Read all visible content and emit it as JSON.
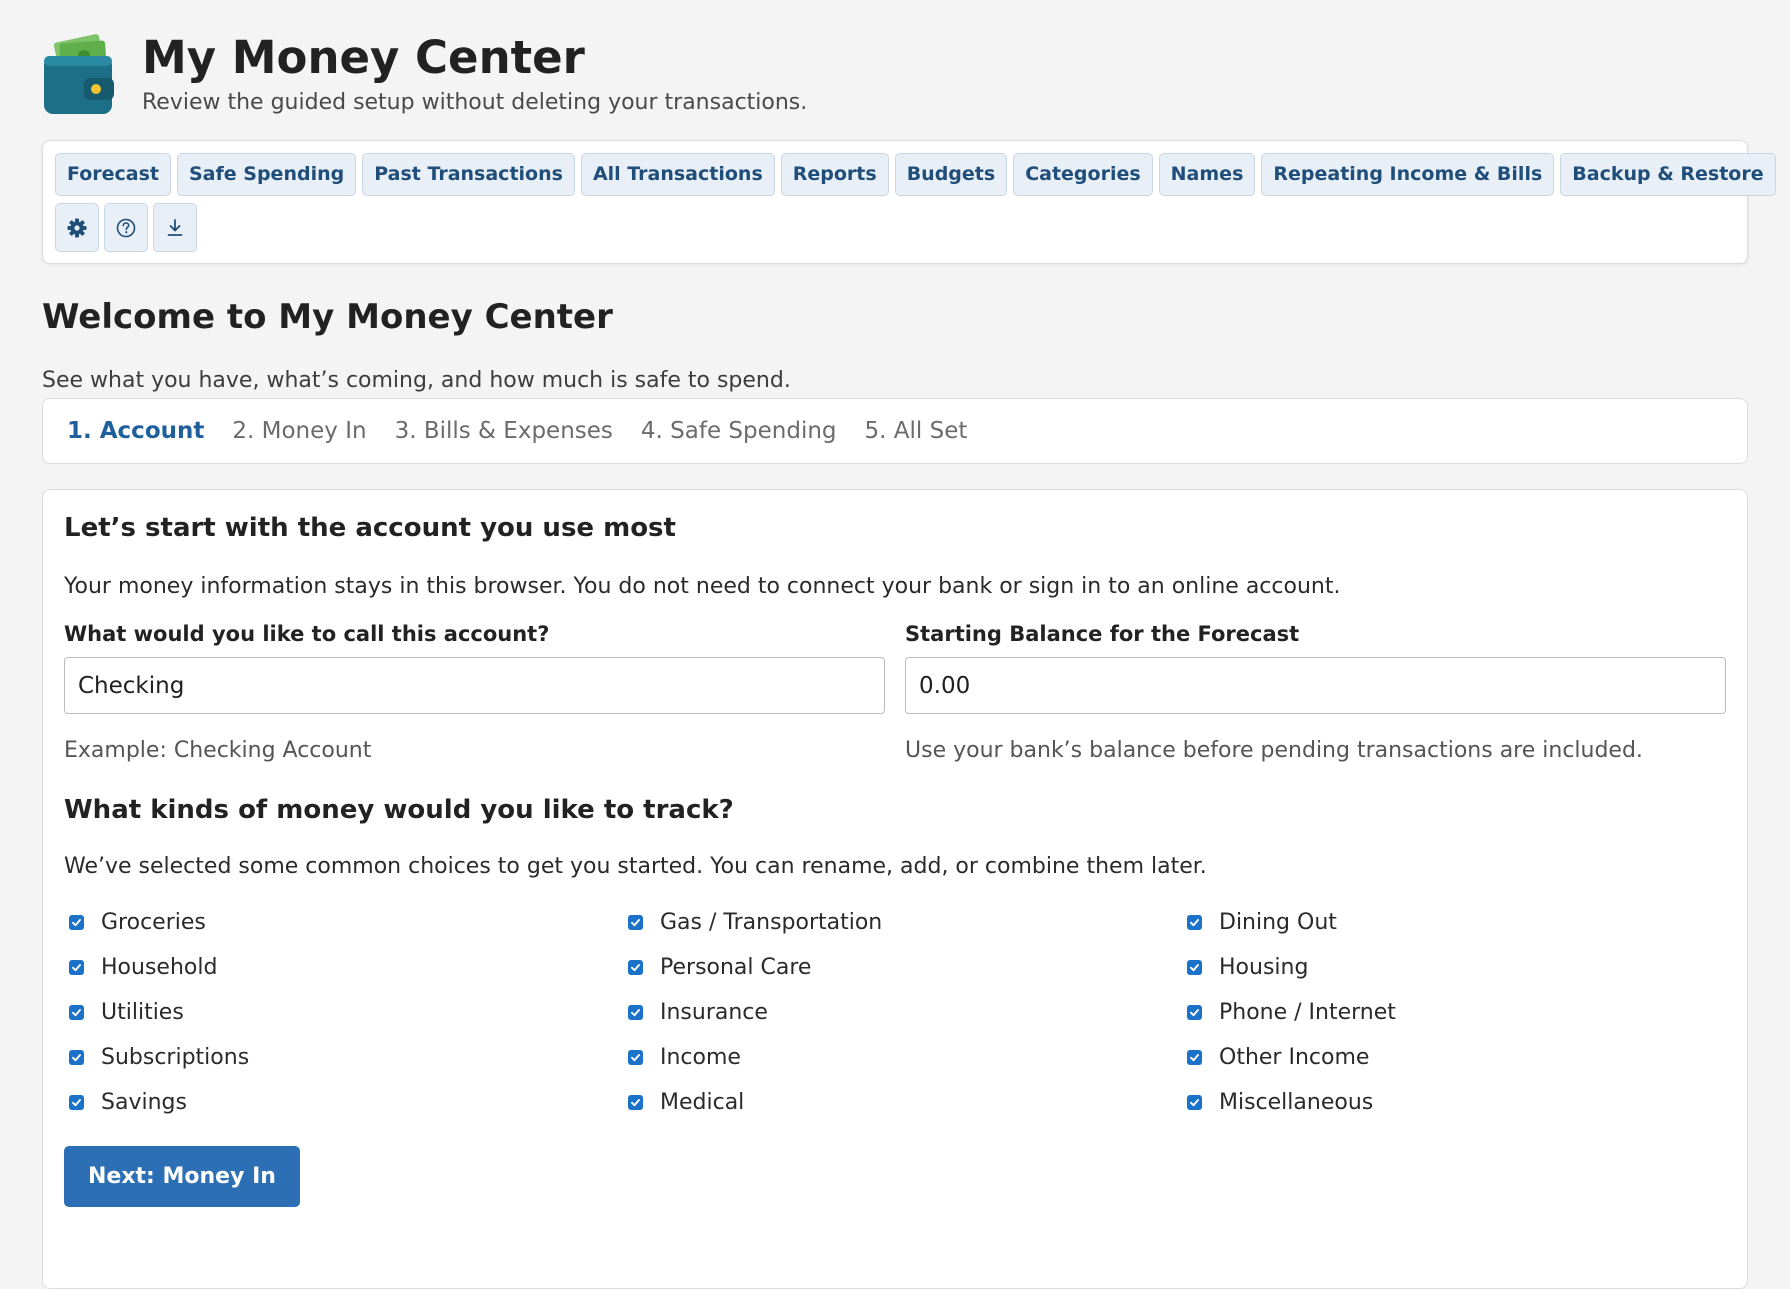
{
  "header": {
    "title": "My Money Center",
    "subtitle": "Review the guided setup without deleting your transactions."
  },
  "nav": {
    "items": [
      {
        "label": "Forecast"
      },
      {
        "label": "Safe Spending"
      },
      {
        "label": "Past Transactions"
      },
      {
        "label": "All Transactions"
      },
      {
        "label": "Reports"
      },
      {
        "label": "Budgets"
      },
      {
        "label": "Categories"
      },
      {
        "label": "Names"
      },
      {
        "label": "Repeating Income & Bills"
      },
      {
        "label": "Backup & Restore"
      }
    ],
    "icons": [
      "gear-icon",
      "help-icon",
      "download-icon"
    ]
  },
  "welcome": {
    "title": "Welcome to My Money Center",
    "subtitle": "See what you have, what’s coming, and how much is safe to spend."
  },
  "steps": [
    {
      "label": "1. Account",
      "active": true
    },
    {
      "label": "2. Money In",
      "active": false
    },
    {
      "label": "3. Bills & Expenses",
      "active": false
    },
    {
      "label": "4. Safe Spending",
      "active": false
    },
    {
      "label": "5. All Set",
      "active": false
    }
  ],
  "account_form": {
    "title": "Let’s start with the account you use most",
    "intro": "Your money information stays in this browser. You do not need to connect your bank or sign in to an online account.",
    "name_field": {
      "label": "What would you like to call this account?",
      "value": "Checking",
      "help": "Example: Checking Account"
    },
    "balance_field": {
      "label": "Starting Balance for the Forecast",
      "value": "0.00",
      "help": "Use your bank’s balance before pending transactions are included."
    },
    "categories_title": "What kinds of money would you like to track?",
    "categories_intro": "We’ve selected some common choices to get you started. You can rename, add, or combine them later.",
    "categories": [
      {
        "label": "Groceries",
        "checked": true
      },
      {
        "label": "Gas / Transportation",
        "checked": true
      },
      {
        "label": "Dining Out",
        "checked": true
      },
      {
        "label": "Household",
        "checked": true
      },
      {
        "label": "Personal Care",
        "checked": true
      },
      {
        "label": "Housing",
        "checked": true
      },
      {
        "label": "Utilities",
        "checked": true
      },
      {
        "label": "Insurance",
        "checked": true
      },
      {
        "label": "Phone / Internet",
        "checked": true
      },
      {
        "label": "Subscriptions",
        "checked": true
      },
      {
        "label": "Income",
        "checked": true
      },
      {
        "label": "Other Income",
        "checked": true
      },
      {
        "label": "Savings",
        "checked": true
      },
      {
        "label": "Medical",
        "checked": true
      },
      {
        "label": "Miscellaneous",
        "checked": true
      }
    ],
    "next_button": "Next: Money In"
  },
  "colors": {
    "accent": "#2c6fb5",
    "nav_text": "#1f4e7a",
    "nav_bg": "#e9eff6",
    "checkbox": "#1a73c8",
    "background": "#f4f4f4"
  }
}
